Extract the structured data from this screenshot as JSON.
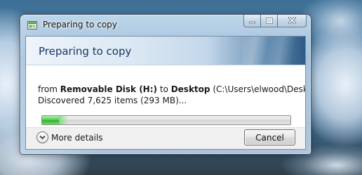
{
  "window": {
    "title": "Preparing to copy"
  },
  "dialog": {
    "main_instruction": "Preparing to copy",
    "from_prefix": "from ",
    "source": "Removable Disk (H:)",
    "to_word": " to ",
    "destination": "Desktop",
    "destination_path": " (C:\\Users\\elwood\\Desktop)",
    "discovered": "Discovered 7,625 items (293 MB)...",
    "progress_fraction": 0.07,
    "more_details_label": "More details",
    "cancel_label": "Cancel"
  },
  "icons": {
    "title_icon": "copy-dialog-icon",
    "minimize": "minimize-icon",
    "maximize": "maximize-icon",
    "close": "close-icon",
    "details_toggle": "chevron-down-circle-icon"
  },
  "colors": {
    "instruction_text": "#1a3566",
    "progress_green": "#2fb82b"
  }
}
